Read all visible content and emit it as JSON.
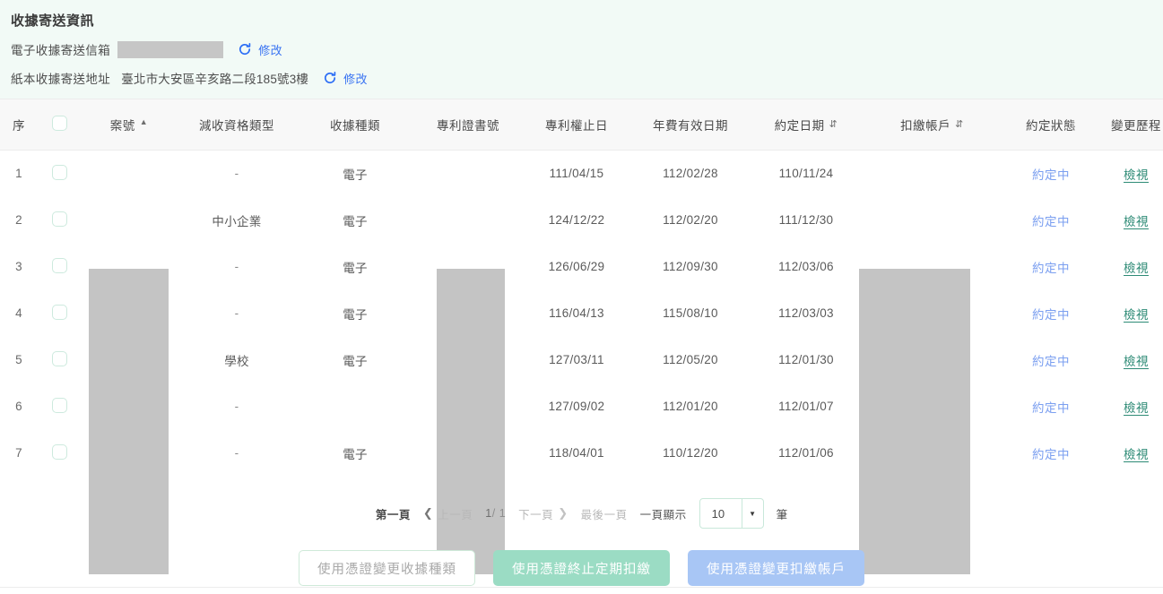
{
  "info": {
    "title": "收據寄送資訊",
    "email_label": "電子收據寄送信箱",
    "email_value": "",
    "email_edit": "修改",
    "address_label": "紙本收據寄送地址",
    "address_value": "臺北市大安區辛亥路二段185號3樓",
    "address_edit": "修改",
    "refresh_icon": "refresh-icon"
  },
  "table": {
    "columns": [
      {
        "key": "seq",
        "label": "序",
        "sort": "none"
      },
      {
        "key": "chk",
        "label": "",
        "sort": "none"
      },
      {
        "key": "case",
        "label": "案號",
        "sort": "asc"
      },
      {
        "key": "type",
        "label": "減收資格類型",
        "sort": "none"
      },
      {
        "key": "rcpt",
        "label": "收據種類",
        "sort": "none"
      },
      {
        "key": "cert",
        "label": "專利證書號",
        "sort": "none"
      },
      {
        "key": "exp",
        "label": "專利權止日",
        "sort": "none"
      },
      {
        "key": "fee",
        "label": "年費有效日期",
        "sort": "none"
      },
      {
        "key": "date",
        "label": "約定日期",
        "sort": "both"
      },
      {
        "key": "acct",
        "label": "扣繳帳戶",
        "sort": "both"
      },
      {
        "key": "stat",
        "label": "約定狀態",
        "sort": "none"
      },
      {
        "key": "hist",
        "label": "變更歷程",
        "sort": "none"
      }
    ],
    "rows": [
      {
        "seq": "1",
        "case": "",
        "type": "-",
        "rcpt": "電子",
        "cert": "",
        "exp": "111/04/15",
        "fee": "112/02/28",
        "date": "110/11/24",
        "acct": "",
        "stat": "約定中",
        "hist": "檢視"
      },
      {
        "seq": "2",
        "case": "",
        "type": "中小企業",
        "rcpt": "電子",
        "cert": "",
        "exp": "124/12/22",
        "fee": "112/02/20",
        "date": "111/12/30",
        "acct": "",
        "stat": "約定中",
        "hist": "檢視"
      },
      {
        "seq": "3",
        "case": "",
        "type": "-",
        "rcpt": "電子",
        "cert": "",
        "exp": "126/06/29",
        "fee": "112/09/30",
        "date": "112/03/06",
        "acct": "",
        "stat": "約定中",
        "hist": "檢視"
      },
      {
        "seq": "4",
        "case": "",
        "type": "-",
        "rcpt": "電子",
        "cert": "",
        "exp": "116/04/13",
        "fee": "115/08/10",
        "date": "112/03/03",
        "acct": "",
        "stat": "約定中",
        "hist": "檢視"
      },
      {
        "seq": "5",
        "case": "",
        "type": "學校",
        "rcpt": "電子",
        "cert": "",
        "exp": "127/03/11",
        "fee": "112/05/20",
        "date": "112/01/30",
        "acct": "",
        "stat": "約定中",
        "hist": "檢視"
      },
      {
        "seq": "6",
        "case": "",
        "type": "-",
        "rcpt": "",
        "cert": "",
        "exp": "127/09/02",
        "fee": "112/01/20",
        "date": "112/01/07",
        "acct": "",
        "stat": "約定中",
        "hist": "檢視"
      },
      {
        "seq": "7",
        "case": "",
        "type": "-",
        "rcpt": "電子",
        "cert": "",
        "exp": "118/04/01",
        "fee": "110/12/20",
        "date": "112/01/06",
        "acct": "",
        "stat": "約定中",
        "hist": "檢視"
      }
    ]
  },
  "pager": {
    "first": "第一頁",
    "prev": "上一頁",
    "current": "1",
    "separator": "/",
    "total": "1",
    "next": "下一頁",
    "last": "最後一頁",
    "per_page_label": "一頁顯示",
    "per_page_value": "10",
    "unit": "筆"
  },
  "actions": {
    "change_receipt_type": "使用憑證變更收據種類",
    "terminate_deduction": "使用憑證終止定期扣繳",
    "change_account": "使用憑證變更扣繳帳戶"
  },
  "colors": {
    "panel_bg": "#f2faf6",
    "link_blue": "#3a74f2",
    "status_blue": "#7b9ff0",
    "hist_green": "#2e8b76",
    "btn_mint": "#9bdcc4",
    "btn_blue": "#a8c6f5",
    "redaction": "#c4c4c4"
  }
}
